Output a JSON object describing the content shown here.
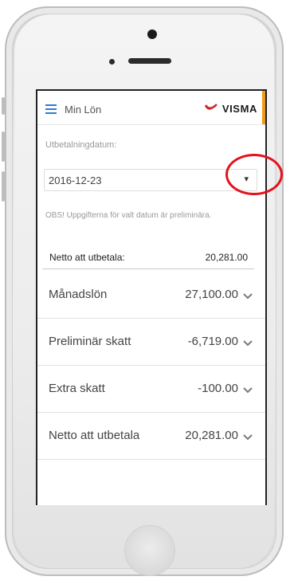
{
  "app": {
    "title": "Min Lön",
    "brand": "VISMA",
    "accent_color": "#f39a1e",
    "menu_icon": "hamburger-menu-icon"
  },
  "payment_date": {
    "label": "Utbetalningdatum:",
    "selected": "2016-12-23",
    "dropdown_icon": "dropdown-caret-icon"
  },
  "notice": "OBS! Uppgifterna för valt datum är preliminära.",
  "net_summary": {
    "label": "Netto att utbetala:",
    "value": "20,281.00"
  },
  "rows": [
    {
      "label": "Månadslön",
      "amount": "27,100.00"
    },
    {
      "label": "Preliminär skatt",
      "amount": "-6,719.00"
    },
    {
      "label": "Extra skatt",
      "amount": "-100.00"
    },
    {
      "label": "Netto att utbetala",
      "amount": "20,281.00"
    }
  ],
  "annotation": {
    "color": "#e3121b",
    "target": "date dropdown caret"
  }
}
